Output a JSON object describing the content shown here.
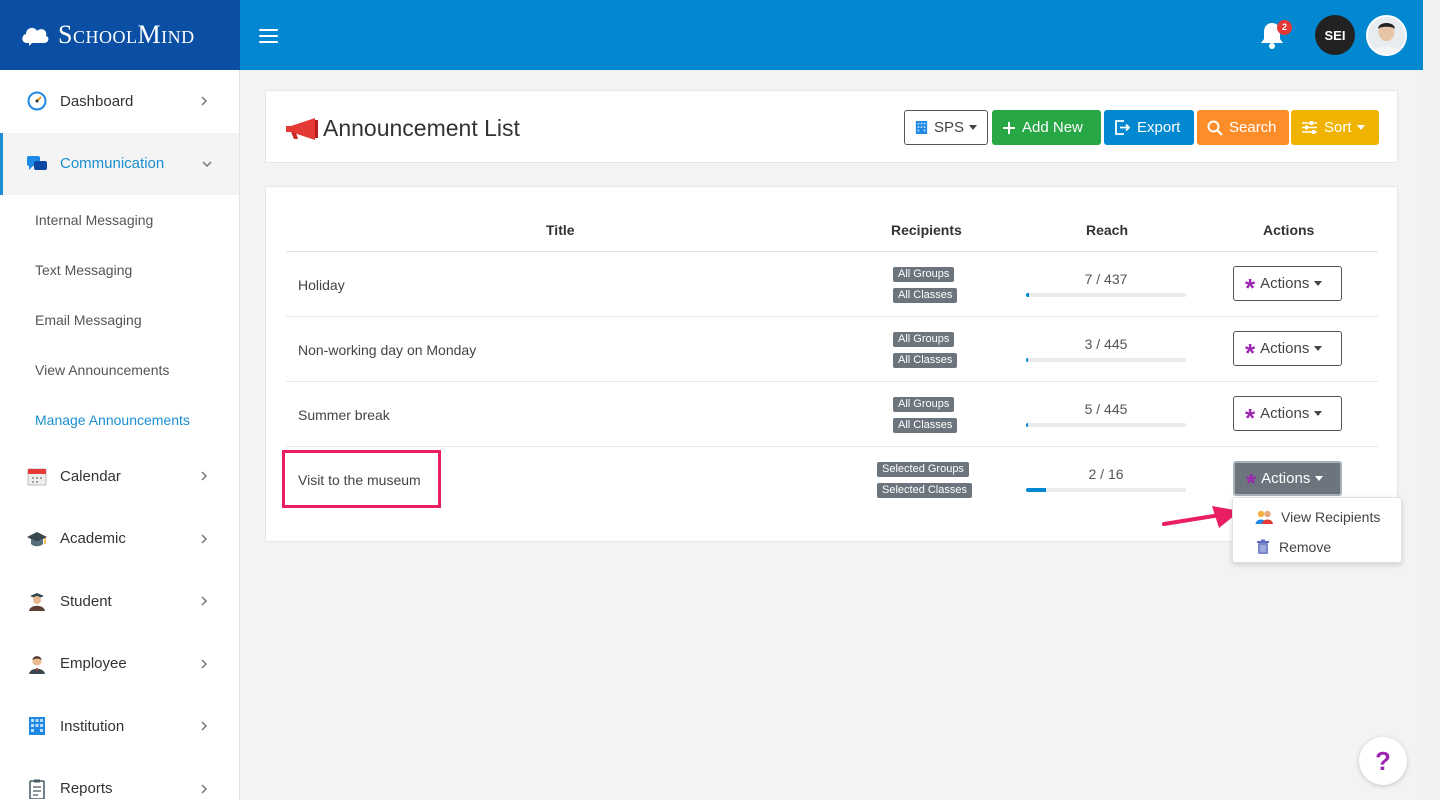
{
  "brand": {
    "name": "SchoolMind"
  },
  "header": {
    "notifications_count": "2",
    "user_initials": "SEI"
  },
  "sidebar": {
    "items": [
      {
        "label": "Dashboard",
        "icon": "dashboard-icon"
      },
      {
        "label": "Communication",
        "icon": "chat-icon",
        "expanded": true
      },
      {
        "label": "Calendar",
        "icon": "calendar-icon"
      },
      {
        "label": "Academic",
        "icon": "graduation-cap-icon"
      },
      {
        "label": "Student",
        "icon": "student-icon"
      },
      {
        "label": "Employee",
        "icon": "employee-icon"
      },
      {
        "label": "Institution",
        "icon": "building-icon"
      },
      {
        "label": "Reports",
        "icon": "clipboard-icon"
      }
    ],
    "sub_items": [
      {
        "label": "Internal Messaging"
      },
      {
        "label": "Text Messaging"
      },
      {
        "label": "Email Messaging"
      },
      {
        "label": "View Announcements"
      },
      {
        "label": "Manage Announcements",
        "active": true
      }
    ]
  },
  "page": {
    "title": "Announcement List",
    "toolbar": {
      "sps": "SPS",
      "add_new": "Add New",
      "export": "Export",
      "search": "Search",
      "sort": "Sort"
    }
  },
  "table": {
    "columns": [
      "Title",
      "Recipients",
      "Reach",
      "Actions"
    ],
    "rows": [
      {
        "title": "Holiday",
        "recipients": [
          "All Groups",
          "All Classes"
        ],
        "reach": "7 / 437",
        "reach_fraction": 0.016,
        "action": "Actions"
      },
      {
        "title": "Non-working day on Monday",
        "recipients": [
          "All Groups",
          "All Classes"
        ],
        "reach": "3 / 445",
        "reach_fraction": 0.007,
        "action": "Actions"
      },
      {
        "title": "Summer break",
        "recipients": [
          "All Groups",
          "All Classes"
        ],
        "reach": "5 / 445",
        "reach_fraction": 0.011,
        "action": "Actions"
      },
      {
        "title": "Visit to the museum",
        "recipients": [
          "Selected Groups",
          "Selected Classes"
        ],
        "reach": "2 / 16",
        "reach_fraction": 0.125,
        "action": "Actions"
      }
    ]
  },
  "actions_menu": {
    "items": [
      {
        "label": "View Recipients",
        "icon": "recipients-icon"
      },
      {
        "label": "Remove",
        "icon": "trash-icon"
      }
    ]
  },
  "help": {
    "label": "?"
  },
  "colors": {
    "brand": "#0a4fa3",
    "topbar": "#0288d1",
    "add": "#28a745",
    "export": "#0288d1",
    "search": "#fd8d29",
    "sort": "#f0b400",
    "accent": "#9c27b0",
    "highlight": "#e91e63"
  }
}
